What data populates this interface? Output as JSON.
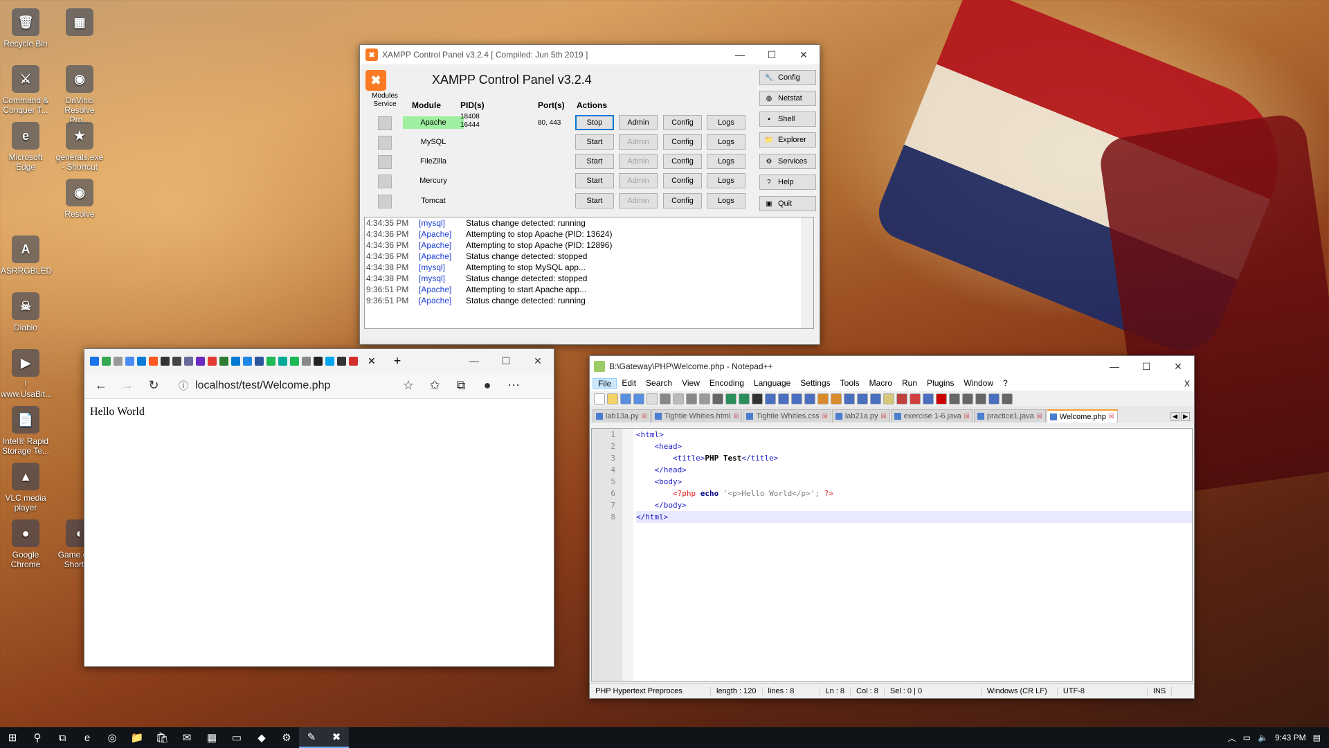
{
  "desktop": {
    "icons": [
      {
        "label": "Recycle Bin",
        "glyph": "🗑"
      },
      {
        "label": "Command & Conquer T...",
        "glyph": "⚔"
      },
      {
        "label": "Microsoft Edge",
        "glyph": "e"
      },
      {
        "label": "ASRRGBLED",
        "glyph": "A"
      },
      {
        "label": "Diablo",
        "glyph": "☠"
      },
      {
        "label": "! www.UsaBit...",
        "glyph": "▶"
      },
      {
        "label": "Intel® Rapid Storage Te...",
        "glyph": "📄"
      },
      {
        "label": "VLC media player",
        "glyph": "▲"
      },
      {
        "label": "Google Chrome",
        "glyph": "●"
      },
      {
        "label": "",
        "glyph": "▦"
      },
      {
        "label": "DaVinci Resolve Pro...",
        "glyph": "◉"
      },
      {
        "label": "generals.exe - Shortcut",
        "glyph": "★"
      },
      {
        "label": "Resolve",
        "glyph": "◉"
      },
      {
        "label": "Game.exe - Shortcut",
        "glyph": "◐"
      }
    ]
  },
  "xampp": {
    "window_title": "XAMPP Control Panel v3.2.4   [ Compiled: Jun 5th 2019 ]",
    "heading": "XAMPP Control Panel v3.2.4",
    "col_modules_service": "Modules\nService",
    "col_module": "Module",
    "col_pids": "PID(s)",
    "col_ports": "Port(s)",
    "col_actions": "Actions",
    "modules": [
      {
        "name": "Apache",
        "pids": "18408\n16444",
        "ports": "80, 443",
        "action": "Stop",
        "admin": "Admin",
        "config": "Config",
        "logs": "Logs",
        "running": true
      },
      {
        "name": "MySQL",
        "pids": "",
        "ports": "",
        "action": "Start",
        "admin": "Admin",
        "config": "Config",
        "logs": "Logs",
        "running": false
      },
      {
        "name": "FileZilla",
        "pids": "",
        "ports": "",
        "action": "Start",
        "admin": "Admin",
        "config": "Config",
        "logs": "Logs",
        "running": false
      },
      {
        "name": "Mercury",
        "pids": "",
        "ports": "",
        "action": "Start",
        "admin": "Admin",
        "config": "Config",
        "logs": "Logs",
        "running": false
      },
      {
        "name": "Tomcat",
        "pids": "",
        "ports": "",
        "action": "Start",
        "admin": "Admin",
        "config": "Config",
        "logs": "Logs",
        "running": false
      }
    ],
    "side_buttons": [
      {
        "label": "Config",
        "icon": "wrench-icon",
        "glyph": "🔧"
      },
      {
        "label": "Netstat",
        "icon": "globe-icon",
        "glyph": "◍"
      },
      {
        "label": "Shell",
        "icon": "terminal-icon",
        "glyph": "▪"
      },
      {
        "label": "Explorer",
        "icon": "folder-icon",
        "glyph": "📁"
      },
      {
        "label": "Services",
        "icon": "services-icon",
        "glyph": "⚙"
      },
      {
        "label": "Help",
        "icon": "help-icon",
        "glyph": "?"
      },
      {
        "label": "Quit",
        "icon": "quit-icon",
        "glyph": "▣"
      }
    ],
    "log": [
      {
        "time": "4:34:35 PM",
        "module": "[mysql]",
        "msg": "Status change detected: running"
      },
      {
        "time": "4:34:36 PM",
        "module": "[Apache]",
        "msg": "Attempting to stop Apache (PID: 13624)"
      },
      {
        "time": "4:34:36 PM",
        "module": "[Apache]",
        "msg": "Attempting to stop Apache (PID: 12896)"
      },
      {
        "time": "4:34:36 PM",
        "module": "[Apache]",
        "msg": "Status change detected: stopped"
      },
      {
        "time": "4:34:38 PM",
        "module": "[mysql]",
        "msg": "Attempting to stop MySQL app..."
      },
      {
        "time": "4:34:38 PM",
        "module": "[mysql]",
        "msg": "Status change detected: stopped"
      },
      {
        "time": "9:36:51 PM",
        "module": "[Apache]",
        "msg": "Attempting to start Apache app..."
      },
      {
        "time": "9:36:51 PM",
        "module": "[Apache]",
        "msg": "Status change detected: running"
      }
    ]
  },
  "edge": {
    "url": "localhost/test/Welcome.php",
    "page_text": "Hello World",
    "new_tab": "+",
    "tab_colors": [
      "#1a73e8",
      "#34a853",
      "#999",
      "#4a8af4",
      "#0a7cd8",
      "#ff5722",
      "#333",
      "#444",
      "#6a6a9a",
      "#6b2bbf",
      "#e53935",
      "#2e7d32",
      "#0078d4",
      "#1e88e5",
      "#2b579a",
      "#1db954",
      "#0a9",
      "#1db954",
      "#888",
      "#222",
      "#00a4ef",
      "#333",
      "#d32f2f"
    ]
  },
  "npp": {
    "window_title": "B:\\Gateway\\PHP\\Welcome.php - Notepad++",
    "close_doc": "X",
    "menu": [
      "File",
      "Edit",
      "Search",
      "View",
      "Encoding",
      "Language",
      "Settings",
      "Tools",
      "Macro",
      "Run",
      "Plugins",
      "Window",
      "?"
    ],
    "tabs": [
      "lab13a.py",
      "Tightie Whities.html",
      "Tightie Whities.css",
      "lab21a.py",
      "exercise 1-6.java",
      "practice1.java",
      "Welcome.php"
    ],
    "active_tab": "Welcome.php",
    "lines": [
      "1",
      "2",
      "3",
      "4",
      "5",
      "6",
      "7",
      "8"
    ],
    "code": {
      "l1": "<html>",
      "l2": "<head>",
      "l3a": "<title>",
      "l3b": "PHP Test",
      "l3c": "</title>",
      "l4": "</head>",
      "l5": "<body>",
      "l6a": "<?php",
      "l6b": "echo",
      "l6c": "'<p>Hello World</p>';",
      "l6d": "?>",
      "l7": "</body>",
      "l8": "</html>"
    },
    "status": {
      "type": "PHP Hypertext Preproces",
      "length": "length : 120",
      "lines": "lines : 8",
      "ln": "Ln : 8",
      "col": "Col : 8",
      "sel": "Sel : 0 | 0",
      "eol": "Windows (CR LF)",
      "enc": "UTF-8",
      "mode": "INS"
    },
    "colors": {
      "tag": "#1e1ec8",
      "php": "#e02020",
      "string": "#808080"
    }
  },
  "taskbar": {
    "time": "9:43 PM",
    "items": [
      "windows-start-icon",
      "search-icon",
      "task-view-icon",
      "edge-icon",
      "firefox-icon",
      "file-explorer-icon",
      "store-icon",
      "mail-icon",
      "app-icon",
      "terminal-icon",
      "vscode-icon",
      "settings-icon",
      "notepadpp-icon",
      "xampp-icon"
    ],
    "glyphs": [
      "⊞",
      "⚲",
      "⧉",
      "e",
      "◎",
      "📁",
      "🛍",
      "✉",
      "▦",
      "▭",
      "◆",
      "⚙",
      "✎",
      "✖"
    ]
  }
}
